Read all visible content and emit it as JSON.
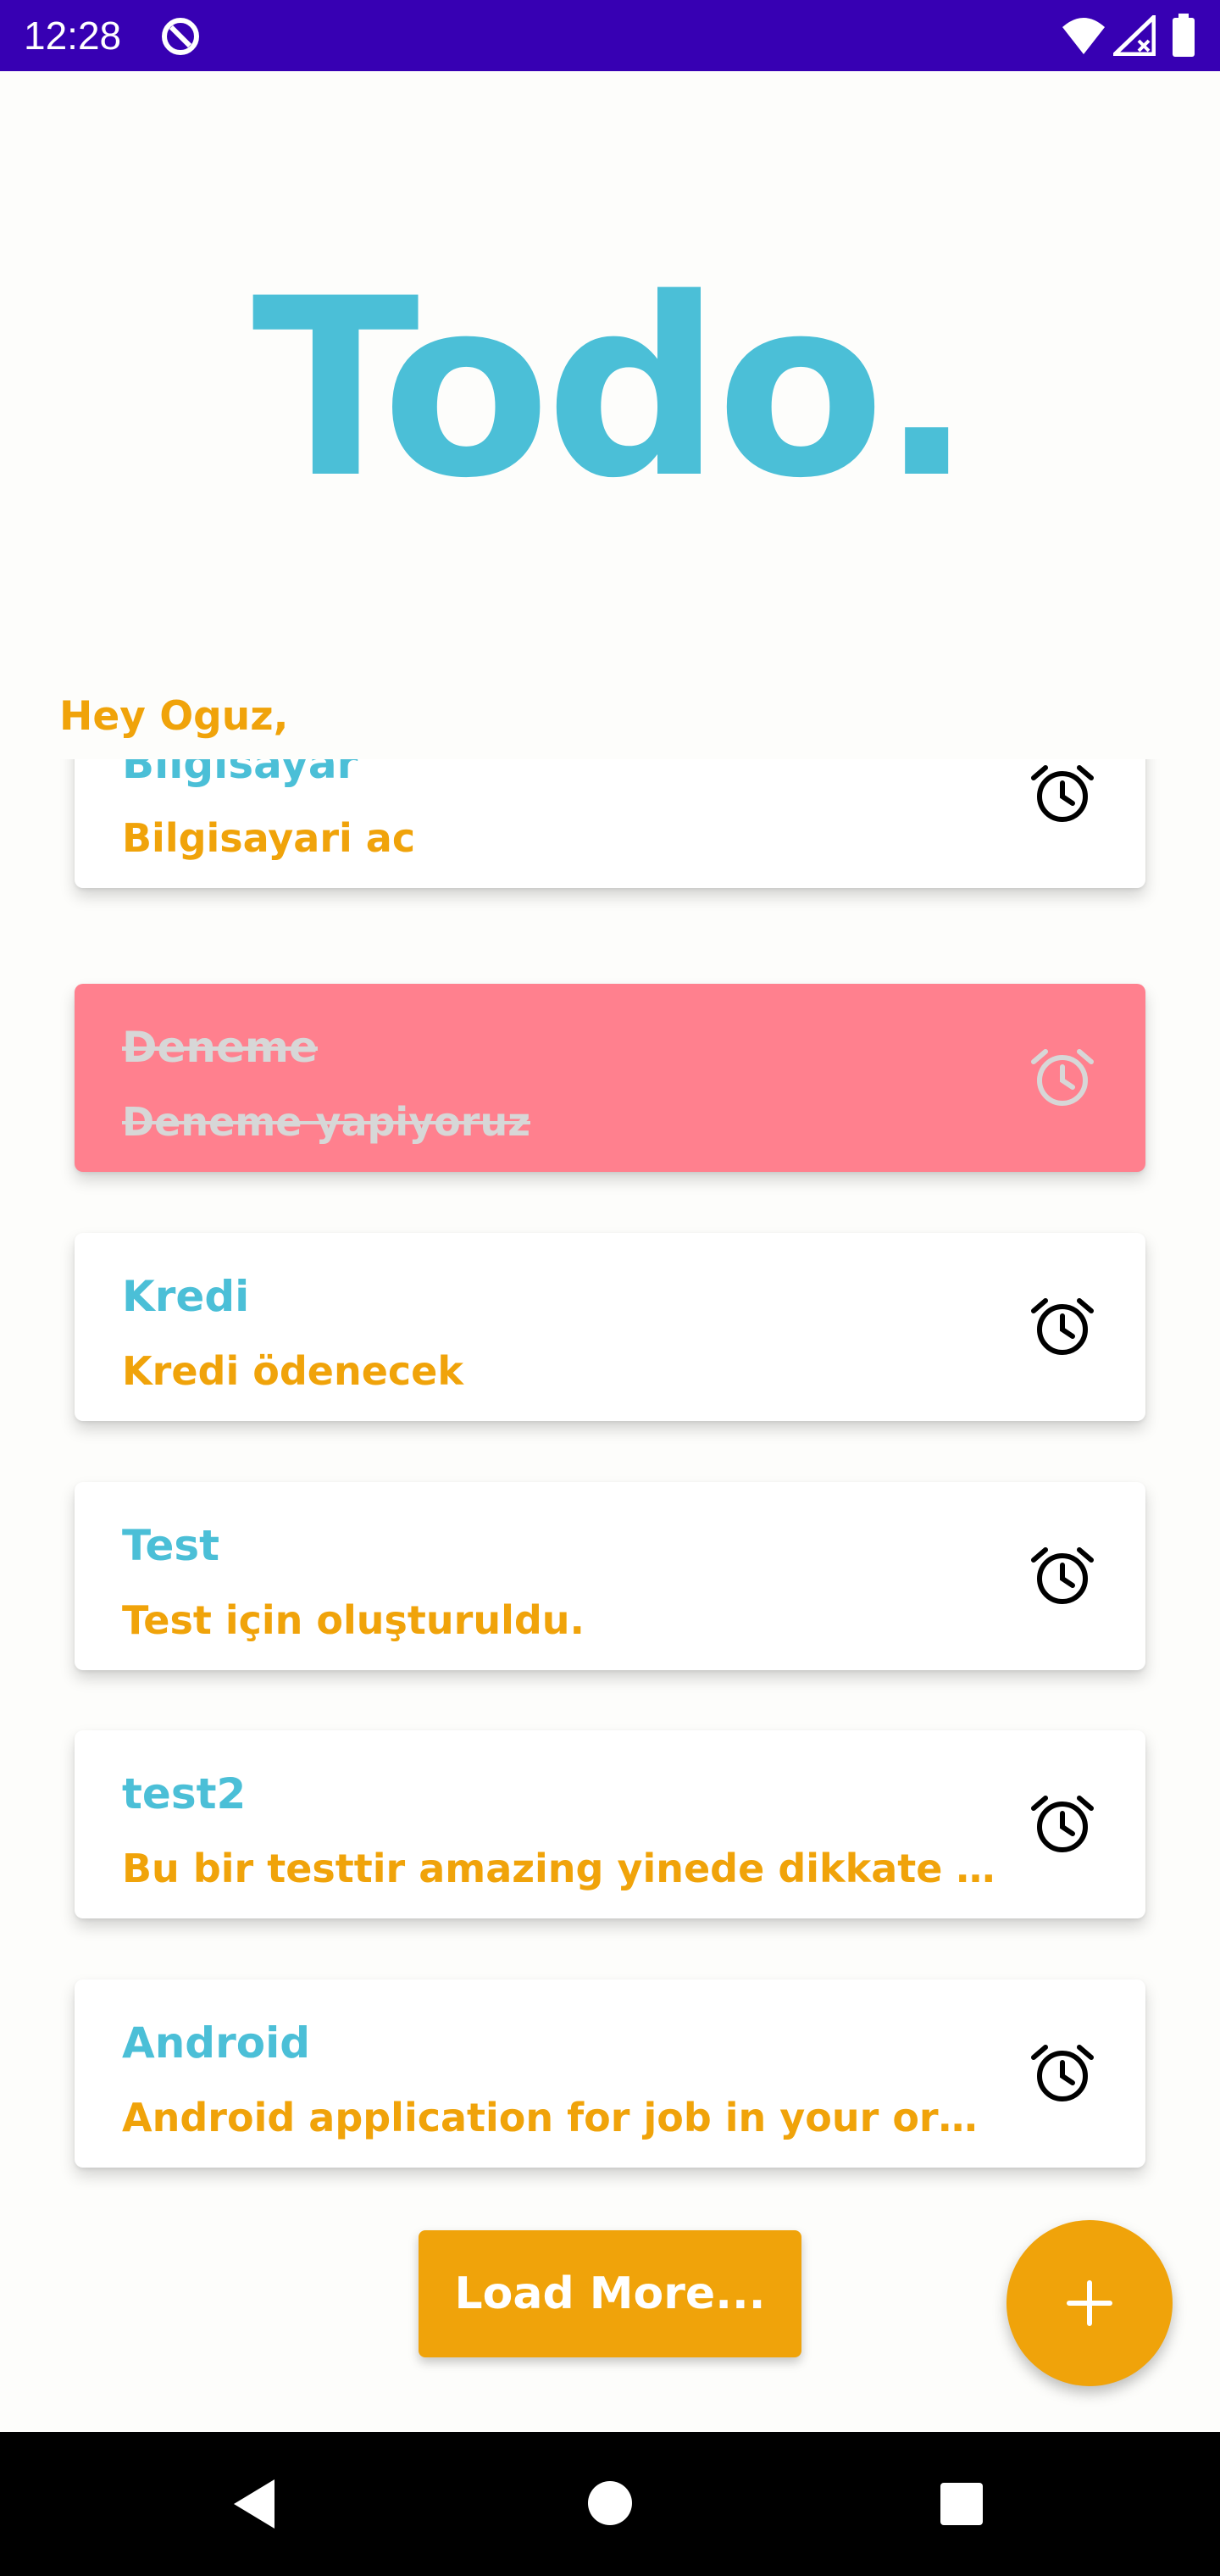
{
  "status_bar": {
    "time": "12:28",
    "background_color": "#3700b3",
    "icons": [
      "app-notification-icon",
      "wifi-icon",
      "signal-icon",
      "battery-icon"
    ]
  },
  "app": {
    "title": "Todo.",
    "greeting": "Hey Oguz,",
    "title_color": "#4bbfd7",
    "accent_color": "#f0a30a",
    "done_color": "#ff808e"
  },
  "todos": [
    {
      "title": "Bilgisayar",
      "description": "Bilgisayari ac",
      "done": false
    },
    {
      "title": "Deneme",
      "description": "Deneme yapiyoruz",
      "done": true
    },
    {
      "title": "Kredi",
      "description": "Kredi ödenecek",
      "done": false
    },
    {
      "title": "Test",
      "description": "Test için oluşturuldu.",
      "done": false
    },
    {
      "title": "test2",
      "description": "Bu bir testtir amazing yinede dikkate al...",
      "done": false
    },
    {
      "title": "Android",
      "description": "Android application for job in your orga...",
      "done": false
    }
  ],
  "load_more_label": "Load More...",
  "fab_icon": "plus-icon",
  "nav_bar": {
    "icons": [
      "back-icon",
      "home-icon",
      "recents-icon"
    ]
  }
}
